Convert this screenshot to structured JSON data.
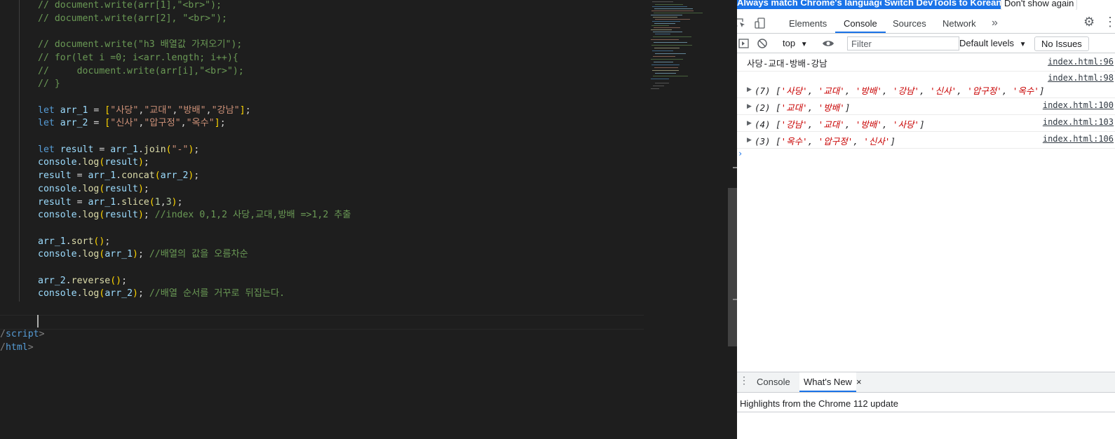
{
  "editor": {
    "lines": [
      {
        "parts": [
          {
            "t": "// document.write(arr[1],\"<br>\");",
            "c": "tk-cmt"
          }
        ]
      },
      {
        "parts": [
          {
            "t": "// document.write(arr[2], \"<br>\");",
            "c": "tk-cmt"
          }
        ]
      },
      {
        "parts": []
      },
      {
        "parts": [
          {
            "t": "// document.write(\"h3 배열값 가져오기\");",
            "c": "tk-cmt"
          }
        ]
      },
      {
        "parts": [
          {
            "t": "// for(let i =0; i<arr.length; i++){",
            "c": "tk-cmt"
          }
        ]
      },
      {
        "parts": [
          {
            "t": "//     document.write(arr[i],\"<br>\");",
            "c": "tk-cmt"
          }
        ]
      },
      {
        "parts": [
          {
            "t": "// }",
            "c": "tk-cmt"
          }
        ]
      },
      {
        "parts": []
      },
      {
        "parts": [
          {
            "t": "let ",
            "c": "tk-kw"
          },
          {
            "t": "arr_1",
            "c": "tk-var"
          },
          {
            "t": " = ",
            "c": "tk-pl"
          },
          {
            "t": "[",
            "c": "tk-br1"
          },
          {
            "t": "\"사당\"",
            "c": "tk-str"
          },
          {
            "t": ",",
            "c": "tk-pl"
          },
          {
            "t": "\"교대\"",
            "c": "tk-str"
          },
          {
            "t": ",",
            "c": "tk-pl"
          },
          {
            "t": "\"방배\"",
            "c": "tk-str"
          },
          {
            "t": ",",
            "c": "tk-pl"
          },
          {
            "t": "\"강남\"",
            "c": "tk-str"
          },
          {
            "t": "]",
            "c": "tk-br1"
          },
          {
            "t": ";",
            "c": "tk-pl"
          }
        ]
      },
      {
        "parts": [
          {
            "t": "let ",
            "c": "tk-kw"
          },
          {
            "t": "arr_2",
            "c": "tk-var"
          },
          {
            "t": " = ",
            "c": "tk-pl"
          },
          {
            "t": "[",
            "c": "tk-br1"
          },
          {
            "t": "\"신사\"",
            "c": "tk-str"
          },
          {
            "t": ",",
            "c": "tk-pl"
          },
          {
            "t": "\"압구정\"",
            "c": "tk-str"
          },
          {
            "t": ",",
            "c": "tk-pl"
          },
          {
            "t": "\"옥수\"",
            "c": "tk-str"
          },
          {
            "t": "]",
            "c": "tk-br1"
          },
          {
            "t": ";",
            "c": "tk-pl"
          }
        ]
      },
      {
        "parts": []
      },
      {
        "parts": [
          {
            "t": "let ",
            "c": "tk-kw"
          },
          {
            "t": "result",
            "c": "tk-var"
          },
          {
            "t": " = ",
            "c": "tk-pl"
          },
          {
            "t": "arr_1",
            "c": "tk-var"
          },
          {
            "t": ".",
            "c": "tk-pl"
          },
          {
            "t": "join",
            "c": "tk-fn"
          },
          {
            "t": "(",
            "c": "tk-br1"
          },
          {
            "t": "\"-\"",
            "c": "tk-str"
          },
          {
            "t": ")",
            "c": "tk-br1"
          },
          {
            "t": ";",
            "c": "tk-pl"
          }
        ]
      },
      {
        "parts": [
          {
            "t": "console",
            "c": "tk-var"
          },
          {
            "t": ".",
            "c": "tk-pl"
          },
          {
            "t": "log",
            "c": "tk-fn"
          },
          {
            "t": "(",
            "c": "tk-br1"
          },
          {
            "t": "result",
            "c": "tk-var"
          },
          {
            "t": ")",
            "c": "tk-br1"
          },
          {
            "t": ";",
            "c": "tk-pl"
          }
        ]
      },
      {
        "parts": [
          {
            "t": "result",
            "c": "tk-var"
          },
          {
            "t": " = ",
            "c": "tk-pl"
          },
          {
            "t": "arr_1",
            "c": "tk-var"
          },
          {
            "t": ".",
            "c": "tk-pl"
          },
          {
            "t": "concat",
            "c": "tk-fn"
          },
          {
            "t": "(",
            "c": "tk-br1"
          },
          {
            "t": "arr_2",
            "c": "tk-var"
          },
          {
            "t": ")",
            "c": "tk-br1"
          },
          {
            "t": ";",
            "c": "tk-pl"
          }
        ]
      },
      {
        "parts": [
          {
            "t": "console",
            "c": "tk-var"
          },
          {
            "t": ".",
            "c": "tk-pl"
          },
          {
            "t": "log",
            "c": "tk-fn"
          },
          {
            "t": "(",
            "c": "tk-br1"
          },
          {
            "t": "result",
            "c": "tk-var"
          },
          {
            "t": ")",
            "c": "tk-br1"
          },
          {
            "t": ";",
            "c": "tk-pl"
          }
        ]
      },
      {
        "parts": [
          {
            "t": "result",
            "c": "tk-var"
          },
          {
            "t": " = ",
            "c": "tk-pl"
          },
          {
            "t": "arr_1",
            "c": "tk-var"
          },
          {
            "t": ".",
            "c": "tk-pl"
          },
          {
            "t": "slice",
            "c": "tk-fn"
          },
          {
            "t": "(",
            "c": "tk-br1"
          },
          {
            "t": "1",
            "c": "tk-num"
          },
          {
            "t": ",",
            "c": "tk-pl"
          },
          {
            "t": "3",
            "c": "tk-num"
          },
          {
            "t": ")",
            "c": "tk-br1"
          },
          {
            "t": ";",
            "c": "tk-pl"
          }
        ]
      },
      {
        "parts": [
          {
            "t": "console",
            "c": "tk-var"
          },
          {
            "t": ".",
            "c": "tk-pl"
          },
          {
            "t": "log",
            "c": "tk-fn"
          },
          {
            "t": "(",
            "c": "tk-br1"
          },
          {
            "t": "result",
            "c": "tk-var"
          },
          {
            "t": ")",
            "c": "tk-br1"
          },
          {
            "t": "; ",
            "c": "tk-pl"
          },
          {
            "t": "//index 0,1,2 사당,교대,방배 =>1,2 추출",
            "c": "tk-cmt"
          }
        ]
      },
      {
        "parts": []
      },
      {
        "parts": [
          {
            "t": "arr_1",
            "c": "tk-var"
          },
          {
            "t": ".",
            "c": "tk-pl"
          },
          {
            "t": "sort",
            "c": "tk-fn"
          },
          {
            "t": "()",
            "c": "tk-br1"
          },
          {
            "t": ";",
            "c": "tk-pl"
          }
        ]
      },
      {
        "parts": [
          {
            "t": "console",
            "c": "tk-var"
          },
          {
            "t": ".",
            "c": "tk-pl"
          },
          {
            "t": "log",
            "c": "tk-fn"
          },
          {
            "t": "(",
            "c": "tk-br1"
          },
          {
            "t": "arr_1",
            "c": "tk-var"
          },
          {
            "t": ")",
            "c": "tk-br1"
          },
          {
            "t": "; ",
            "c": "tk-pl"
          },
          {
            "t": "//배열의 값을 오름차순",
            "c": "tk-cmt"
          }
        ]
      },
      {
        "parts": []
      },
      {
        "parts": [
          {
            "t": "arr_2",
            "c": "tk-var"
          },
          {
            "t": ".",
            "c": "tk-pl"
          },
          {
            "t": "reverse",
            "c": "tk-fn"
          },
          {
            "t": "()",
            "c": "tk-br1"
          },
          {
            "t": ";",
            "c": "tk-pl"
          }
        ]
      },
      {
        "parts": [
          {
            "t": "console",
            "c": "tk-var"
          },
          {
            "t": ".",
            "c": "tk-pl"
          },
          {
            "t": "log",
            "c": "tk-fn"
          },
          {
            "t": "(",
            "c": "tk-br1"
          },
          {
            "t": "arr_2",
            "c": "tk-var"
          },
          {
            "t": ")",
            "c": "tk-br1"
          },
          {
            "t": "; ",
            "c": "tk-pl"
          },
          {
            "t": "//배열 순서를 거꾸로 뒤집는다.",
            "c": "tk-cmt"
          }
        ]
      }
    ],
    "closing_lines": [
      {
        "parts": [
          {
            "t": "/",
            "c": "tk-ang"
          },
          {
            "t": "script",
            "c": "tk-tag"
          },
          {
            "t": ">",
            "c": "tk-ang"
          }
        ]
      },
      {
        "parts": [
          {
            "t": "/",
            "c": "tk-ang"
          },
          {
            "t": "html",
            "c": "tk-tag"
          },
          {
            "t": ">",
            "c": "tk-ang"
          }
        ]
      }
    ]
  },
  "devtools": {
    "infobar": {
      "match_language": "Always match Chrome's language",
      "switch_korean": "Switch DevTools to Korean",
      "dont_show": "Don't show again"
    },
    "tabs": [
      "Elements",
      "Console",
      "Sources",
      "Network"
    ],
    "active_tab": "Console",
    "more_tabs_icon": "»",
    "settings_icon": "⚙",
    "kebab_icon": "⋮",
    "toolbar": {
      "context": "top",
      "filter_placeholder": "Filter",
      "levels": "Default levels",
      "issues": "No Issues"
    },
    "messages": [
      {
        "text": "사당-교대-방배-강남",
        "source": "index.html:96"
      },
      {
        "count": "(7)",
        "items": [
          "사당",
          "교대",
          "방배",
          "강남",
          "신사",
          "압구정",
          "옥수"
        ],
        "source": "index.html:98"
      },
      {
        "count": "(2)",
        "items": [
          "교대",
          "방배"
        ],
        "source": "index.html:100"
      },
      {
        "count": "(4)",
        "items": [
          "강남",
          "교대",
          "방배",
          "사당"
        ],
        "source": "index.html:103"
      },
      {
        "count": "(3)",
        "items": [
          "옥수",
          "압구정",
          "신사"
        ],
        "source": "index.html:106"
      }
    ],
    "prompt_caret": "›",
    "drawer": {
      "tabs": [
        "Console",
        "What's New"
      ],
      "active_tab": "What's New",
      "close_icon": "×",
      "highlights": "Highlights from the Chrome 112 update"
    }
  }
}
